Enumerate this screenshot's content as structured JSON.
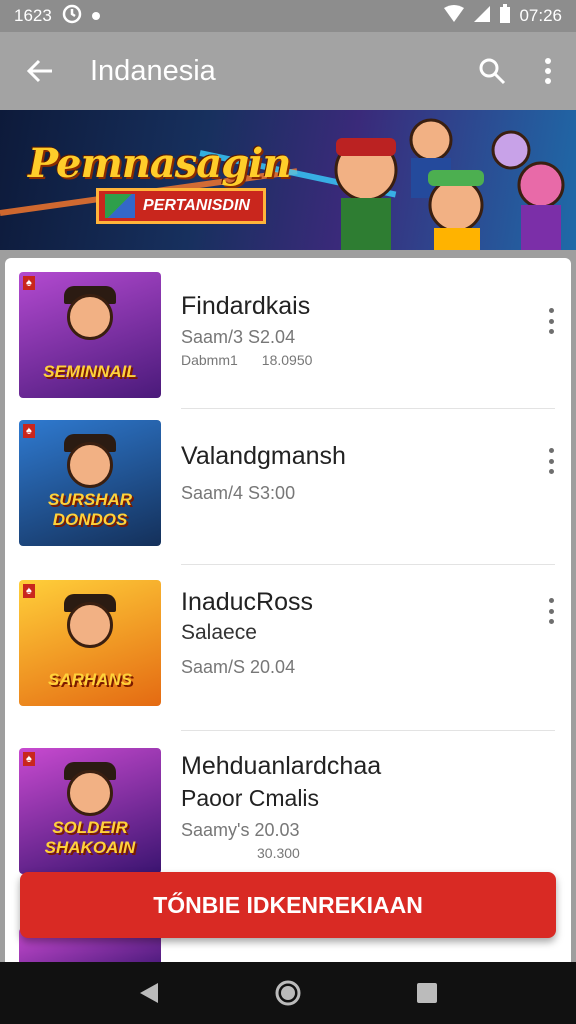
{
  "status_bar": {
    "left_time": "1623",
    "right_time": "07:26"
  },
  "app_bar": {
    "title": "Indanesia"
  },
  "banner": {
    "headline": "Pemnasagin",
    "cta_label": "PERTANISDIN"
  },
  "games": [
    {
      "title": "Findardkais",
      "subtitle": "",
      "meta": "Saam/3 S2.04",
      "extra_left": "Dabmm1",
      "extra_right": "18.0950",
      "thumb_text": "SEMINNAIL",
      "thumb_bg": "#7a2a9a"
    },
    {
      "title": "Valandgmansh",
      "subtitle": "",
      "meta": "Saam/4 S3:00",
      "extra_left": "",
      "extra_right": "",
      "thumb_text": "SURSHAR DONDOS",
      "thumb_bg": "#1f4f8a"
    },
    {
      "title": "InaducRoss",
      "subtitle": "Salaece",
      "meta": "Saam/S 20.04",
      "extra_left": "",
      "extra_right": "",
      "thumb_text": "SARHANS",
      "thumb_bg": "#f0a030"
    },
    {
      "title": "Mehduanlardchaa",
      "subtitle": "Paoor Cmalis",
      "meta": "Saamy's 20.03",
      "extra_left": "",
      "extra_right": "30.300",
      "thumb_text": "SOLDEIR SHAKOAIN",
      "thumb_bg": "#8a2a8a"
    }
  ],
  "primary_button": {
    "label": "TŐNBIE IDKENREKIAAN"
  },
  "colors": {
    "accent": "#d92a24",
    "appbar": "#a3a3a3",
    "statusbar": "#8d8d8d"
  }
}
